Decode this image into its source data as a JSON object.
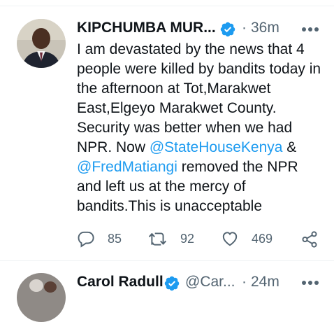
{
  "tweet1": {
    "display_name": "KIPCHUMBA MUR...",
    "separator": "·",
    "time": "36m",
    "text_parts": [
      "I am devastated by the news that 4 people were killed by bandits today in the afternoon at Tot,Marakwet East,Elgeyo Marakwet County. Security was better when we had NPR. Now ",
      "@StateHouseKenya",
      " & ",
      "@FredMatiangi",
      " removed the NPR and left us at the mercy of bandits.This is unacceptable"
    ],
    "actions": {
      "reply_count": "85",
      "retweet_count": "92",
      "like_count": "469"
    }
  },
  "tweet2": {
    "display_name": "Carol Radull",
    "handle": "@Car...",
    "separator": "·",
    "time": "24m"
  },
  "colors": {
    "accent": "#1d9bf0",
    "text": "#0f1419",
    "secondary": "#536471",
    "divider": "#eff3f4"
  },
  "icons": {
    "verified": "verified-badge-icon",
    "more": "more-dots-icon",
    "reply": "reply-icon",
    "retweet": "retweet-icon",
    "like": "heart-icon",
    "share": "share-icon"
  }
}
